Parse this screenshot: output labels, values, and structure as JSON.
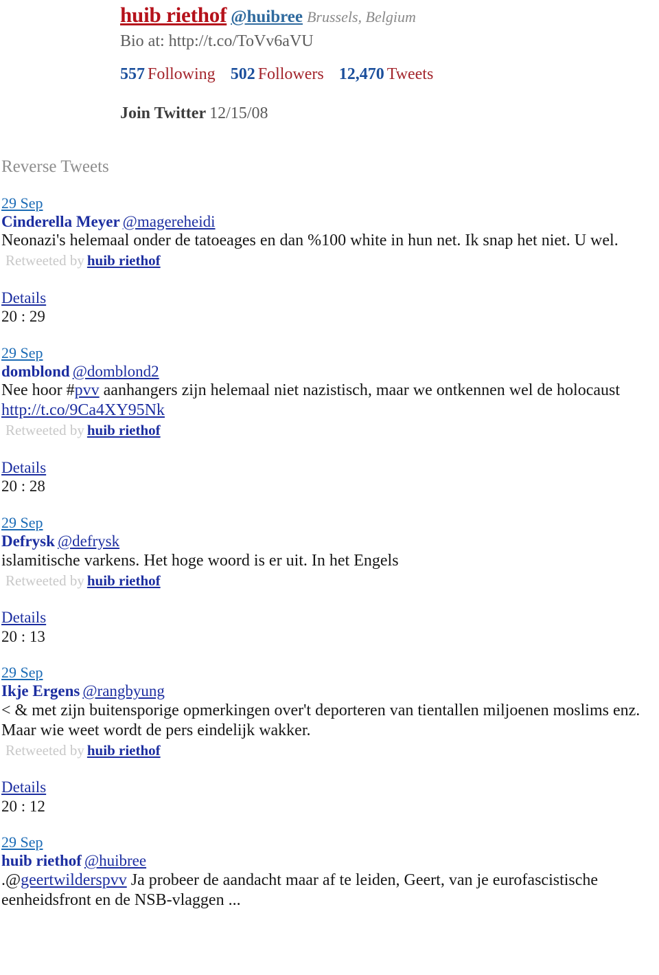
{
  "profile": {
    "display_name": "huib riethof",
    "handle": "@huibree",
    "location": "Brussels, Belgium",
    "bio": "Bio at: http://t.co/ToVv6aVU",
    "stats": [
      {
        "number": "557",
        "label": "Following"
      },
      {
        "number": "502",
        "label": "Followers"
      },
      {
        "number": "12,470",
        "label": "Tweets"
      }
    ],
    "join_label": "Join Twitter",
    "join_date": "12/15/08"
  },
  "section": {
    "title": "Reverse Tweets"
  },
  "tweets": [
    {
      "date": "29 Sep",
      "author_name": "Cinderella Meyer",
      "author_handle": "@magereheidi",
      "text_before": "Neonazi's helemaal onder de tatoeages en dan %100 white in hun net. Ik snap het niet. U wel.",
      "link_text": "",
      "text_after": "",
      "extra_link": "",
      "retweet_label": "Retweeted by",
      "retweet_user": "huib riethof",
      "details_label": "Details",
      "time": "20 : 29"
    },
    {
      "date": "29 Sep",
      "author_name": "domblond",
      "author_handle": "@domblond2",
      "text_before": "Nee hoor #",
      "link_text": "pvv",
      "text_after": " aanhangers zijn helemaal niet nazistisch, maar we ontkennen wel de holocaust",
      "extra_link": "http://t.co/9Ca4XY95Nk",
      "retweet_label": "Retweeted by",
      "retweet_user": "huib riethof",
      "details_label": "Details",
      "time": "20 : 28"
    },
    {
      "date": "29 Sep",
      "author_name": "Defrysk",
      "author_handle": "@defrysk",
      "text_before": "islamitische varkens. Het hoge woord is er uit. In het Engels",
      "link_text": "",
      "text_after": "",
      "extra_link": "",
      "retweet_label": "Retweeted by",
      "retweet_user": "huib riethof",
      "details_label": "Details",
      "time": "20 : 13"
    },
    {
      "date": "29 Sep",
      "author_name": "Ikje Ergens",
      "author_handle": "@rangbyung",
      "text_before": "< & met zijn buitensporige opmerkingen over't deporteren van tientallen miljoenen moslims enz. Maar wie weet wordt de pers eindelijk wakker.",
      "link_text": "",
      "text_after": "",
      "extra_link": "",
      "retweet_label": "Retweeted by",
      "retweet_user": "huib riethof",
      "details_label": "Details",
      "time": "20 : 12"
    },
    {
      "date": "29 Sep",
      "author_name": "huib riethof",
      "author_handle": "@huibree",
      "text_before": ".@",
      "link_text": "geertwilderspvv",
      "text_after": " Ja probeer de aandacht maar af te leiden, Geert, van je eurofascistische eenheidsfront en de NSB-vlaggen ...",
      "extra_link": "",
      "retweet_label": "",
      "retweet_user": "",
      "details_label": "",
      "time": ""
    }
  ],
  "colors": {
    "display_name": "#b5121b",
    "handle_blue": "#2f6a9e",
    "stat_number": "#1b4f9c",
    "stat_label": "#a3242b",
    "link_blue": "#1c2ea0",
    "date_blue": "#1a6ab5",
    "muted_gray": "#8d8d8d"
  }
}
